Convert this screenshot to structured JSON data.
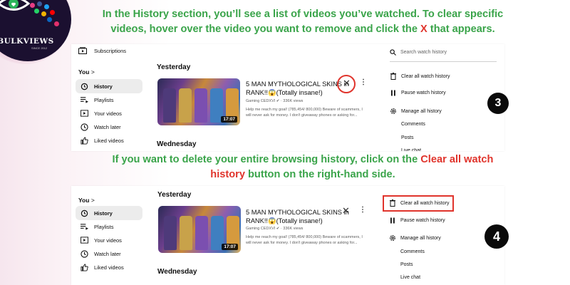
{
  "brand": {
    "name": "BULKVIEWS",
    "tagline": "SINCE 2012"
  },
  "instructions": {
    "step3": {
      "line1": "In the History section, you’ll see a list of videos you’ve watched. To clear specific",
      "line2_pre": "videos, hover over the video you want to remove and click the",
      "line2_x": "X",
      "line2_post": "that appears."
    },
    "step4": {
      "line1_pre": "If you want to delete your entire browsing history, click on the",
      "line1_red": "Clear all watch",
      "line2_red": "history",
      "line2_post": "button on the right-hand side."
    }
  },
  "steps": {
    "three": "3",
    "four": "4"
  },
  "panel1": {
    "sidebar": {
      "subscriptions": "Subscriptions",
      "you": "You",
      "you_chevron": ">",
      "items": [
        "History",
        "Playlists",
        "Your videos",
        "Watch later",
        "Liked videos"
      ]
    },
    "sections": {
      "yesterday": "Yesterday",
      "wednesday": "Wednesday"
    },
    "video": {
      "title": "5 MAN MYTHOLOGICAL SKINS in RANK!!😱(Totally insane!)",
      "channel": "Gaming CEDXVI",
      "verified": "✔",
      "views": "336K views",
      "description": "Help me reach my goal! (785,454/ 800,000) Beware of scammers, I will never ask for money. I don't giveaway phones or asking for...",
      "duration": "17:07",
      "remove": "✕",
      "more": "⋮"
    },
    "right": {
      "search_placeholder": "Search watch history",
      "clear": "Clear all watch history",
      "pause": "Pause watch history",
      "manage": "Manage all history",
      "comments": "Comments",
      "posts": "Posts",
      "livechat": "Live chat"
    }
  },
  "panel2": {
    "sidebar": {
      "you": "You",
      "you_chevron": ">",
      "items": [
        "History",
        "Playlists",
        "Your videos",
        "Watch later",
        "Liked videos"
      ]
    },
    "sections": {
      "yesterday": "Yesterday",
      "wednesday": "Wednesday"
    },
    "video": {
      "title": "5 MAN MYTHOLOGICAL SKINS in RANK!!😱(Totally insane!)",
      "channel": "Gaming CEDXVI",
      "verified": "✔",
      "views": "336K views",
      "description": "Help me reach my goal! (785,454/ 800,000) Beware of scammers, I will never ask for money. I don't giveaway phones or asking for...",
      "duration": "17:07",
      "remove": "✕",
      "more": "⋮"
    },
    "right": {
      "clear": "Clear all watch history",
      "pause": "Pause watch history",
      "manage": "Manage all history",
      "comments": "Comments",
      "posts": "Posts",
      "livechat": "Live chat"
    }
  },
  "colors": {
    "green": "#3aa44a",
    "red": "#e0342c",
    "logo_bg": "#1b1030"
  },
  "icons": [
    "history-icon",
    "playlist-icon",
    "play-icon",
    "clock-icon",
    "thumbs-up-icon",
    "trash-icon",
    "pause-icon",
    "gear-icon",
    "search-icon",
    "subscriptions-icon"
  ]
}
